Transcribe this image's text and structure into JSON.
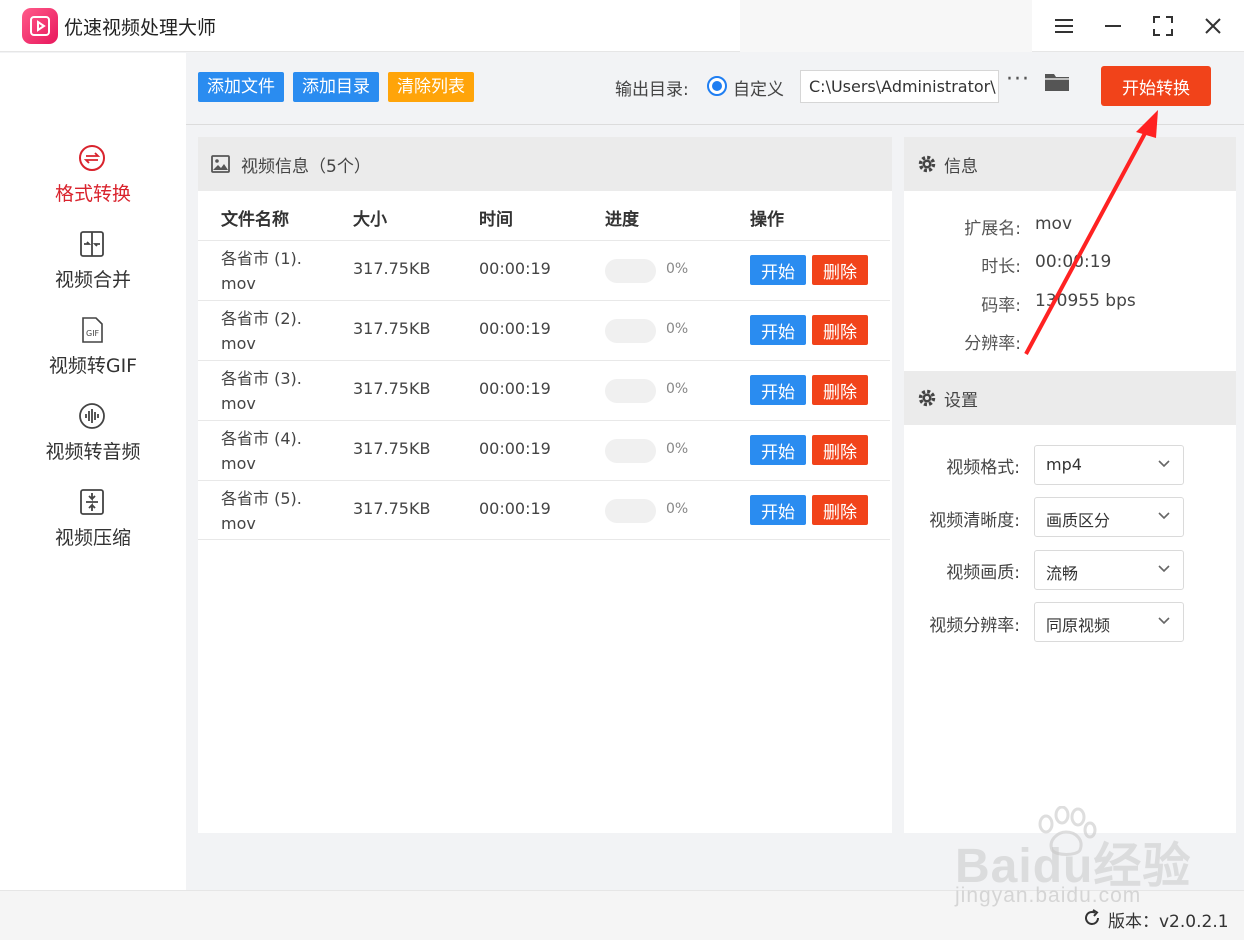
{
  "app": {
    "title": "优速视频处理大师"
  },
  "sidebar": {
    "items": [
      {
        "label": "格式转换",
        "icon": "convert-icon",
        "active": true
      },
      {
        "label": "视频合并",
        "icon": "merge-icon",
        "active": false
      },
      {
        "label": "视频转GIF",
        "icon": "gif-icon",
        "active": false
      },
      {
        "label": "视频转音频",
        "icon": "audio-icon",
        "active": false
      },
      {
        "label": "视频压缩",
        "icon": "compress-icon",
        "active": false
      }
    ]
  },
  "toolbar": {
    "add_file": "添加文件",
    "add_dir": "添加目录",
    "clear_list": "清除列表",
    "output_label": "输出目录:",
    "custom_label": "自定义",
    "output_path": "C:\\Users\\Administrator\\",
    "more": "···",
    "start_all": "开始转换"
  },
  "video_panel": {
    "title": "视频信息（5个）",
    "columns": {
      "name": "文件名称",
      "size": "大小",
      "time": "时间",
      "progress": "进度",
      "action": "操作"
    },
    "rows": [
      {
        "name_line1": "各省市 (1).",
        "name_line2": "mov",
        "size": "317.75KB",
        "time": "00:00:19",
        "progress": 0,
        "progress_text": "0%",
        "start": "开始",
        "delete": "删除"
      },
      {
        "name_line1": "各省市 (2).",
        "name_line2": "mov",
        "size": "317.75KB",
        "time": "00:00:19",
        "progress": 0,
        "progress_text": "0%",
        "start": "开始",
        "delete": "删除"
      },
      {
        "name_line1": "各省市 (3).",
        "name_line2": "mov",
        "size": "317.75KB",
        "time": "00:00:19",
        "progress": 0,
        "progress_text": "0%",
        "start": "开始",
        "delete": "删除"
      },
      {
        "name_line1": "各省市 (4).",
        "name_line2": "mov",
        "size": "317.75KB",
        "time": "00:00:19",
        "progress": 0,
        "progress_text": "0%",
        "start": "开始",
        "delete": "删除"
      },
      {
        "name_line1": "各省市 (5).",
        "name_line2": "mov",
        "size": "317.75KB",
        "time": "00:00:19",
        "progress": 0,
        "progress_text": "0%",
        "start": "开始",
        "delete": "删除"
      }
    ]
  },
  "info": {
    "title": "信息",
    "ext_label": "扩展名:",
    "ext_value": "mov",
    "duration_label": "时长:",
    "duration_value": "00:00:19",
    "bitrate_label": "码率:",
    "bitrate_value": "130955 bps",
    "resolution_label": "分辨率:"
  },
  "settings": {
    "title": "设置",
    "format_label": "视频格式:",
    "format_value": "mp4",
    "clarity_label": "视频清晰度:",
    "clarity_value": "画质区分",
    "quality_label": "视频画质:",
    "quality_value": "流畅",
    "resolution_label": "视频分辨率:",
    "resolution_value": "同原视频"
  },
  "footer": {
    "version": "版本：v2.0.2.1"
  },
  "watermark": {
    "main": "Baidu经验",
    "sub": "jingyan.baidu.com"
  },
  "colors": {
    "accent_blue": "#2a8cf0",
    "danger_red": "#f1431a",
    "warning_orange": "#ffa409",
    "active_nav": "#d9232d"
  }
}
